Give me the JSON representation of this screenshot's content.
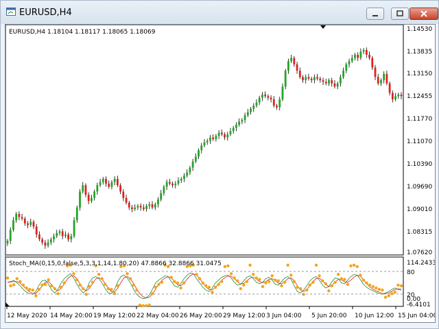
{
  "window": {
    "title": "EURUSD,H4"
  },
  "main_chart": {
    "header": "EURUSD,H4  1.18104 1.18117 1.18065 1.18069",
    "price_labels": [
      "1.14530",
      "1.13835",
      "1.13150",
      "1.12455",
      "1.11770",
      "1.11070",
      "1.10390",
      "1.09690",
      "1.09010",
      "1.08315",
      "1.07620"
    ],
    "up_color": "#22a422",
    "down_color": "#e02020"
  },
  "indicator": {
    "header": "Stoch_MA(0,15,0,false,5,3,3,1,14,1.80,20) 47.8866 32.8866 31.0475",
    "max_label": "114.2433",
    "level_high": "80",
    "level_low": "20",
    "min_label": "-6.4101",
    "min_label_partial": "0.00",
    "dot_color": "#f5a31a",
    "main_line_color": "#2a8a2a",
    "signal_line_color": "#d42020"
  },
  "time_axis": {
    "labels": [
      "12 May 2020",
      "14 May 20:00",
      "19 May 12:00",
      "22 May 04:00",
      "26 May 20:00",
      "29 May 12:00",
      "3 Jun 04:00",
      "5 Jun 20:00",
      "10 Jun 12:00",
      "15 Jun 04:00"
    ]
  },
  "chart_data": {
    "type": "candlestick",
    "symbol": "EURUSD",
    "timeframe": "H4",
    "ylim": [
      1.0755,
      1.1466
    ],
    "close_series_approx": [
      1.0795,
      1.083,
      1.086,
      1.088,
      1.087,
      1.0865,
      1.085,
      1.0845,
      1.0855,
      1.084,
      1.0815,
      1.08,
      1.079,
      1.078,
      1.079,
      1.08,
      1.081,
      1.082,
      1.0825,
      1.081,
      1.0815,
      1.08,
      1.081,
      1.086,
      1.09,
      1.095,
      1.097,
      1.094,
      1.092,
      1.093,
      1.095,
      1.097,
      1.098,
      1.099,
      1.0975,
      1.0965,
      1.098,
      1.099,
      1.097,
      1.095,
      1.093,
      1.0915,
      1.09,
      1.0895,
      1.09,
      1.0905,
      1.09,
      1.0895,
      1.0905,
      1.091,
      1.09,
      1.091,
      1.0925,
      1.0945,
      1.0965,
      1.098,
      1.0975,
      1.097,
      1.0975,
      1.0985,
      1.099,
      1.1,
      1.101,
      1.1025,
      1.1045,
      1.106,
      1.108,
      1.1095,
      1.1105,
      1.111,
      1.112,
      1.1115,
      1.1125,
      1.1135,
      1.113,
      1.112,
      1.113,
      1.114,
      1.115,
      1.116,
      1.117,
      1.1175,
      1.119,
      1.12,
      1.121,
      1.122,
      1.123,
      1.1245,
      1.1255,
      1.125,
      1.1245,
      1.124,
      1.122,
      1.1215,
      1.124,
      1.128,
      1.133,
      1.136,
      1.137,
      1.135,
      1.133,
      1.131,
      1.13,
      1.131,
      1.1305,
      1.13,
      1.131,
      1.1305,
      1.13,
      1.1295,
      1.129,
      1.13,
      1.129,
      1.128,
      1.129,
      1.131,
      1.133,
      1.135,
      1.136,
      1.137,
      1.138,
      1.137,
      1.139,
      1.1395,
      1.138,
      1.137,
      1.134,
      1.131,
      1.129,
      1.13,
      1.132,
      1.129,
      1.126,
      1.124,
      1.125,
      1.1255,
      1.125
    ],
    "stoch_main_approx": [
      60,
      62,
      65,
      58,
      50,
      40,
      32,
      28,
      26,
      34,
      52,
      64,
      66,
      55,
      38,
      30,
      40,
      58,
      70,
      78,
      84,
      72,
      55,
      40,
      30,
      38,
      60,
      72,
      76,
      70,
      58,
      42,
      30,
      28,
      40,
      62,
      76,
      80,
      72,
      58,
      40,
      26,
      18,
      14,
      16,
      24,
      40,
      58,
      66,
      72,
      78,
      76,
      62,
      50,
      46,
      56,
      70,
      80,
      86,
      84,
      70,
      58,
      46,
      38,
      34,
      44,
      58,
      66,
      74,
      78,
      80,
      72,
      60,
      52,
      54,
      64,
      74,
      78,
      70,
      60,
      56,
      60,
      70,
      74,
      66,
      54,
      52,
      62,
      72,
      76,
      68,
      50,
      34,
      30,
      38,
      50,
      64,
      72,
      76,
      66,
      52,
      44,
      48,
      62,
      72,
      70,
      58,
      56,
      66,
      76,
      82,
      80,
      68,
      54,
      46,
      40,
      36,
      32,
      28,
      26,
      30,
      34,
      40,
      44,
      40,
      38
    ]
  }
}
